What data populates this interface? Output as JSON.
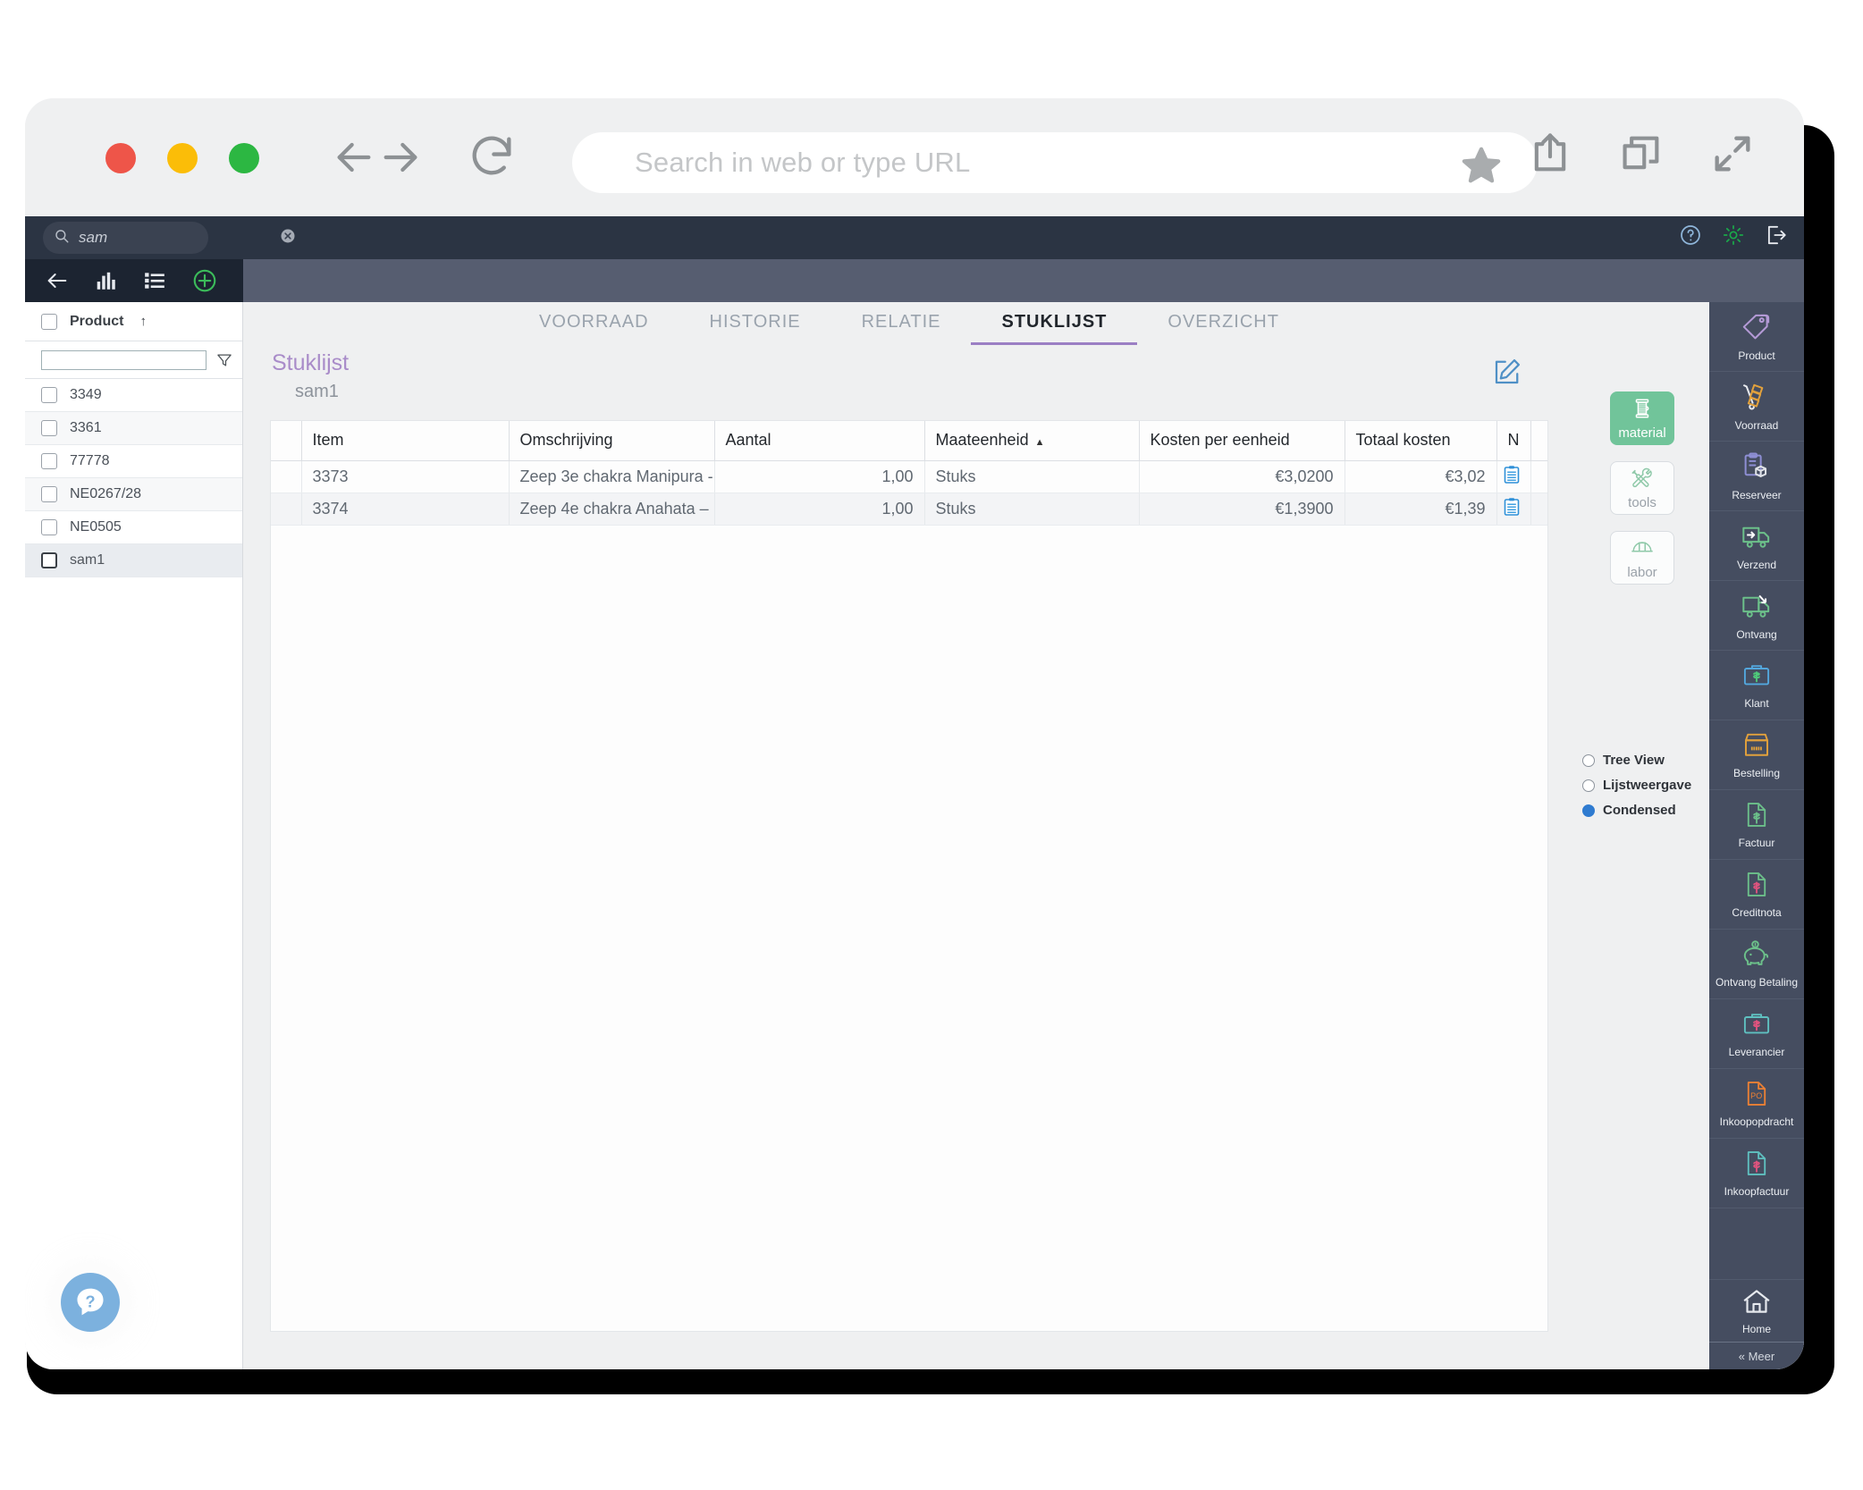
{
  "browser": {
    "url_placeholder": "Search in web or type URL",
    "icons": {
      "back": "arrow-left-icon",
      "forward": "arrow-right-icon",
      "reload": "reload-icon",
      "bookmark": "star-icon",
      "share": "share-icon",
      "tabs": "copy-tabs-icon",
      "fullscreen": "expand-icon"
    }
  },
  "app_topbar": {
    "search_value": "sam",
    "search_placeholder": "",
    "clear_icon": "clear-circle-icon",
    "help_icon": "help-circle-icon",
    "settings_icon": "gear-icon",
    "logout_icon": "logout-icon"
  },
  "tool_strip": {
    "back_icon": "arrow-left-icon",
    "chart_icon": "bar-chart-icon",
    "list_icon": "list-icon",
    "add_icon": "plus-circle-icon"
  },
  "sidebar": {
    "header_label": "Product",
    "sort_indicator": "↑",
    "filter_value": "",
    "filter_icon": "funnel-icon",
    "items": [
      {
        "label": "3349",
        "selected": false
      },
      {
        "label": "3361",
        "selected": false
      },
      {
        "label": "77778",
        "selected": false
      },
      {
        "label": "NE0267/28",
        "selected": false
      },
      {
        "label": "NE0505",
        "selected": false
      },
      {
        "label": "sam1",
        "selected": true
      }
    ],
    "help_icon": "question-chat-icon"
  },
  "tabs": [
    {
      "label": "VOORRAAD",
      "active": false
    },
    {
      "label": "HISTORIE",
      "active": false
    },
    {
      "label": "RELATIE",
      "active": false
    },
    {
      "label": "STUKLIJST",
      "active": true
    },
    {
      "label": "OVERZICHT",
      "active": false
    }
  ],
  "page": {
    "title": "Stuklijst",
    "subtitle": "sam1",
    "edit_icon": "edit-pencil-icon"
  },
  "table": {
    "columns": [
      "Item",
      "Omschrijving",
      "Aantal",
      "Maateenheid",
      "Kosten per eenheid",
      "Totaal kosten",
      "N"
    ],
    "sort_column": "Maateenheid",
    "sort_indicator": "▲",
    "rows": [
      {
        "item": "3373",
        "omschrijving": "Zeep 3e chakra Manipura -",
        "aantal": "1,00",
        "maateenheid": "Stuks",
        "kosten_per_eenheid": "€3,0200",
        "totaal_kosten": "€3,02",
        "n_icon": "note-clipboard-icon"
      },
      {
        "item": "3374",
        "omschrijving": "Zeep 4e chakra Anahata –",
        "aantal": "1,00",
        "maateenheid": "Stuks",
        "kosten_per_eenheid": "€1,3900",
        "totaal_kosten": "€1,39",
        "n_icon": "note-clipboard-icon"
      }
    ]
  },
  "right_panel": {
    "type_buttons": [
      {
        "label": "material",
        "icon": "spool-icon",
        "active": true
      },
      {
        "label": "tools",
        "icon": "tools-icon",
        "active": false
      },
      {
        "label": "labor",
        "icon": "hardhat-icon",
        "active": false
      }
    ],
    "view_options": [
      {
        "label": "Tree View",
        "selected": false
      },
      {
        "label": "Lijstweergave",
        "selected": false
      },
      {
        "label": "Condensed",
        "selected": true
      }
    ]
  },
  "rail": {
    "items": [
      {
        "label": "Product",
        "icon": "price-tags-icon",
        "color": "#b49ad6"
      },
      {
        "label": "Voorraad",
        "icon": "hand-truck-icon",
        "color": "#e2a13c"
      },
      {
        "label": "Reserveer",
        "icon": "clipboard-box-icon",
        "color": "#8d8ed3"
      },
      {
        "label": "Verzend",
        "icon": "truck-out-icon",
        "color": "#6cc08a"
      },
      {
        "label": "Ontvang",
        "icon": "truck-in-icon",
        "color": "#6cc08a"
      },
      {
        "label": "Klant",
        "icon": "briefcase-dollar-icon",
        "color": "#53a7dd"
      },
      {
        "label": "Bestelling",
        "icon": "open-box-icon",
        "color": "#e2a13c"
      },
      {
        "label": "Factuur",
        "icon": "invoice-dollar-icon",
        "color": "#6cc08a"
      },
      {
        "label": "Creditnota",
        "icon": "credit-note-icon",
        "color": "#6cc08a"
      },
      {
        "label": "Ontvang Betaling",
        "icon": "piggy-bank-icon",
        "color": "#6cc08a"
      },
      {
        "label": "Leverancier",
        "icon": "briefcase-supplier-icon",
        "color": "#5fc0c0"
      },
      {
        "label": "Inkoopopdracht",
        "icon": "po-document-icon",
        "color": "#ec8034"
      },
      {
        "label": "Inkoopfactuur",
        "icon": "purchase-invoice-icon",
        "color": "#5fc0c0"
      }
    ],
    "home_label": "Home",
    "home_icon": "home-icon",
    "more_label": "« Meer"
  },
  "colors": {
    "accent_purple": "#a98cc9",
    "rail_bg": "#454d60",
    "topbar_bg": "#2b3443",
    "active_green": "#71c49a",
    "radio_blue": "#2f7bd0"
  }
}
